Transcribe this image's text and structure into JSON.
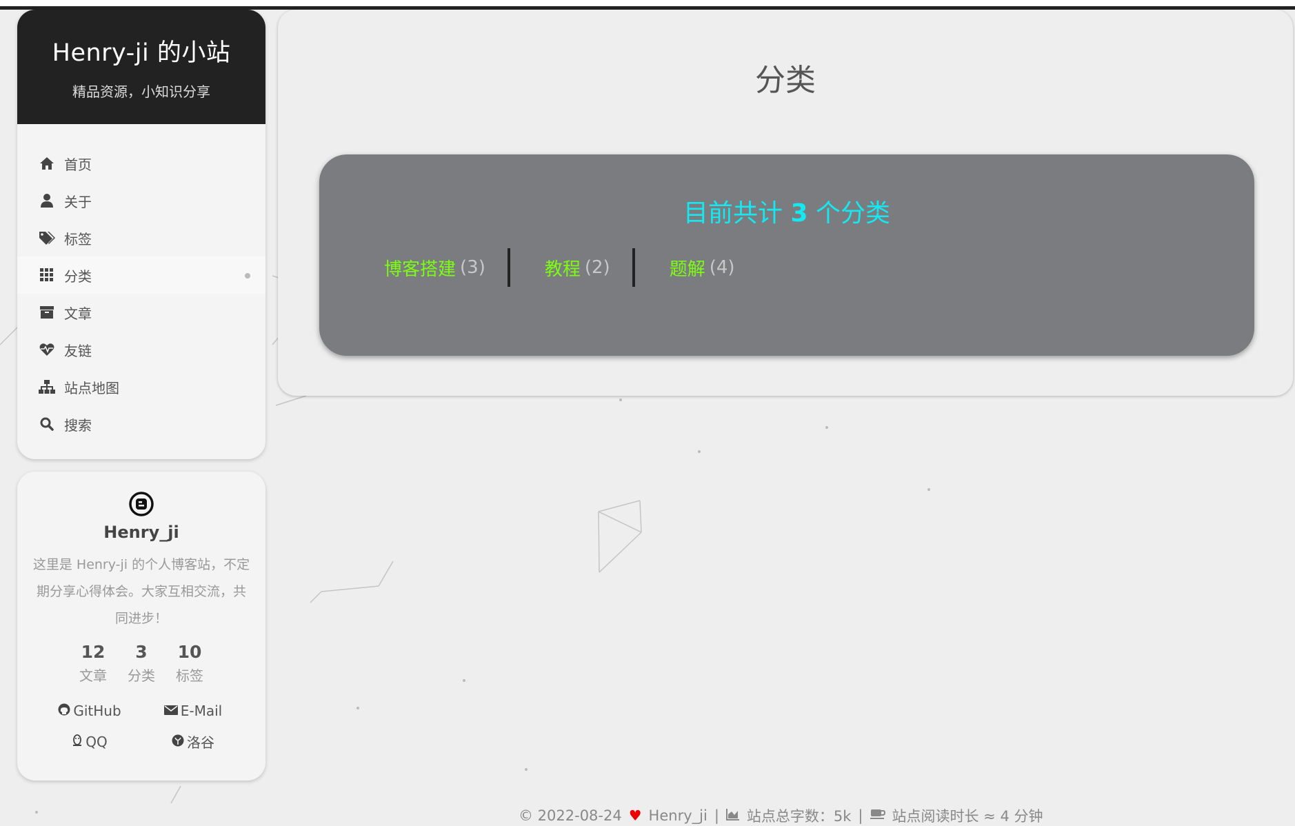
{
  "site": {
    "title": "Henry-ji 的小站",
    "subtitle": "精品资源，小知识分享"
  },
  "menu": [
    {
      "label": "首页",
      "icon": "home-icon"
    },
    {
      "label": "关于",
      "icon": "user-icon"
    },
    {
      "label": "标签",
      "icon": "tags-icon"
    },
    {
      "label": "分类",
      "icon": "grid-icon",
      "active": true
    },
    {
      "label": "文章",
      "icon": "archive-icon"
    },
    {
      "label": "友链",
      "icon": "heartbeat-icon"
    },
    {
      "label": "站点地图",
      "icon": "sitemap-icon"
    },
    {
      "label": "搜索",
      "icon": "search-icon"
    }
  ],
  "profile": {
    "name": "Henry_ji",
    "description": "这里是 Henry-ji 的个人博客站，不定期分享心得体会。大家互相交流，共同进步！",
    "stats": [
      {
        "num": "12",
        "label": "文章"
      },
      {
        "num": "3",
        "label": "分类"
      },
      {
        "num": "10",
        "label": "标签"
      }
    ],
    "links": [
      {
        "label": "GitHub",
        "icon": "github-icon"
      },
      {
        "label": "E-Mail",
        "icon": "envelope-icon"
      },
      {
        "label": "QQ",
        "icon": "qq-icon"
      },
      {
        "label": "洛谷",
        "icon": "luogu-icon"
      }
    ]
  },
  "main": {
    "page_title": "分类",
    "summary_prefix": "目前共计",
    "summary_count": "3",
    "summary_suffix": "个分类",
    "categories": [
      {
        "name": "博客搭建",
        "count": "(3)"
      },
      {
        "name": "教程",
        "count": "(2)"
      },
      {
        "name": "题解",
        "count": "(4)"
      }
    ]
  },
  "footer": {
    "copyright": "© 2022-08-24",
    "author": "Henry_ji",
    "sep": "|",
    "word_count": "站点总字数：5k",
    "read_time": "站点阅读时长 ≈ 4 分钟"
  },
  "colors": {
    "brand_bg": "#222222",
    "page_bg": "#eeeeee",
    "category_box": "#7a7c7f",
    "summary_text": "#14e8f0",
    "category_link": "#7cfc14",
    "heart": "#ee0000"
  }
}
